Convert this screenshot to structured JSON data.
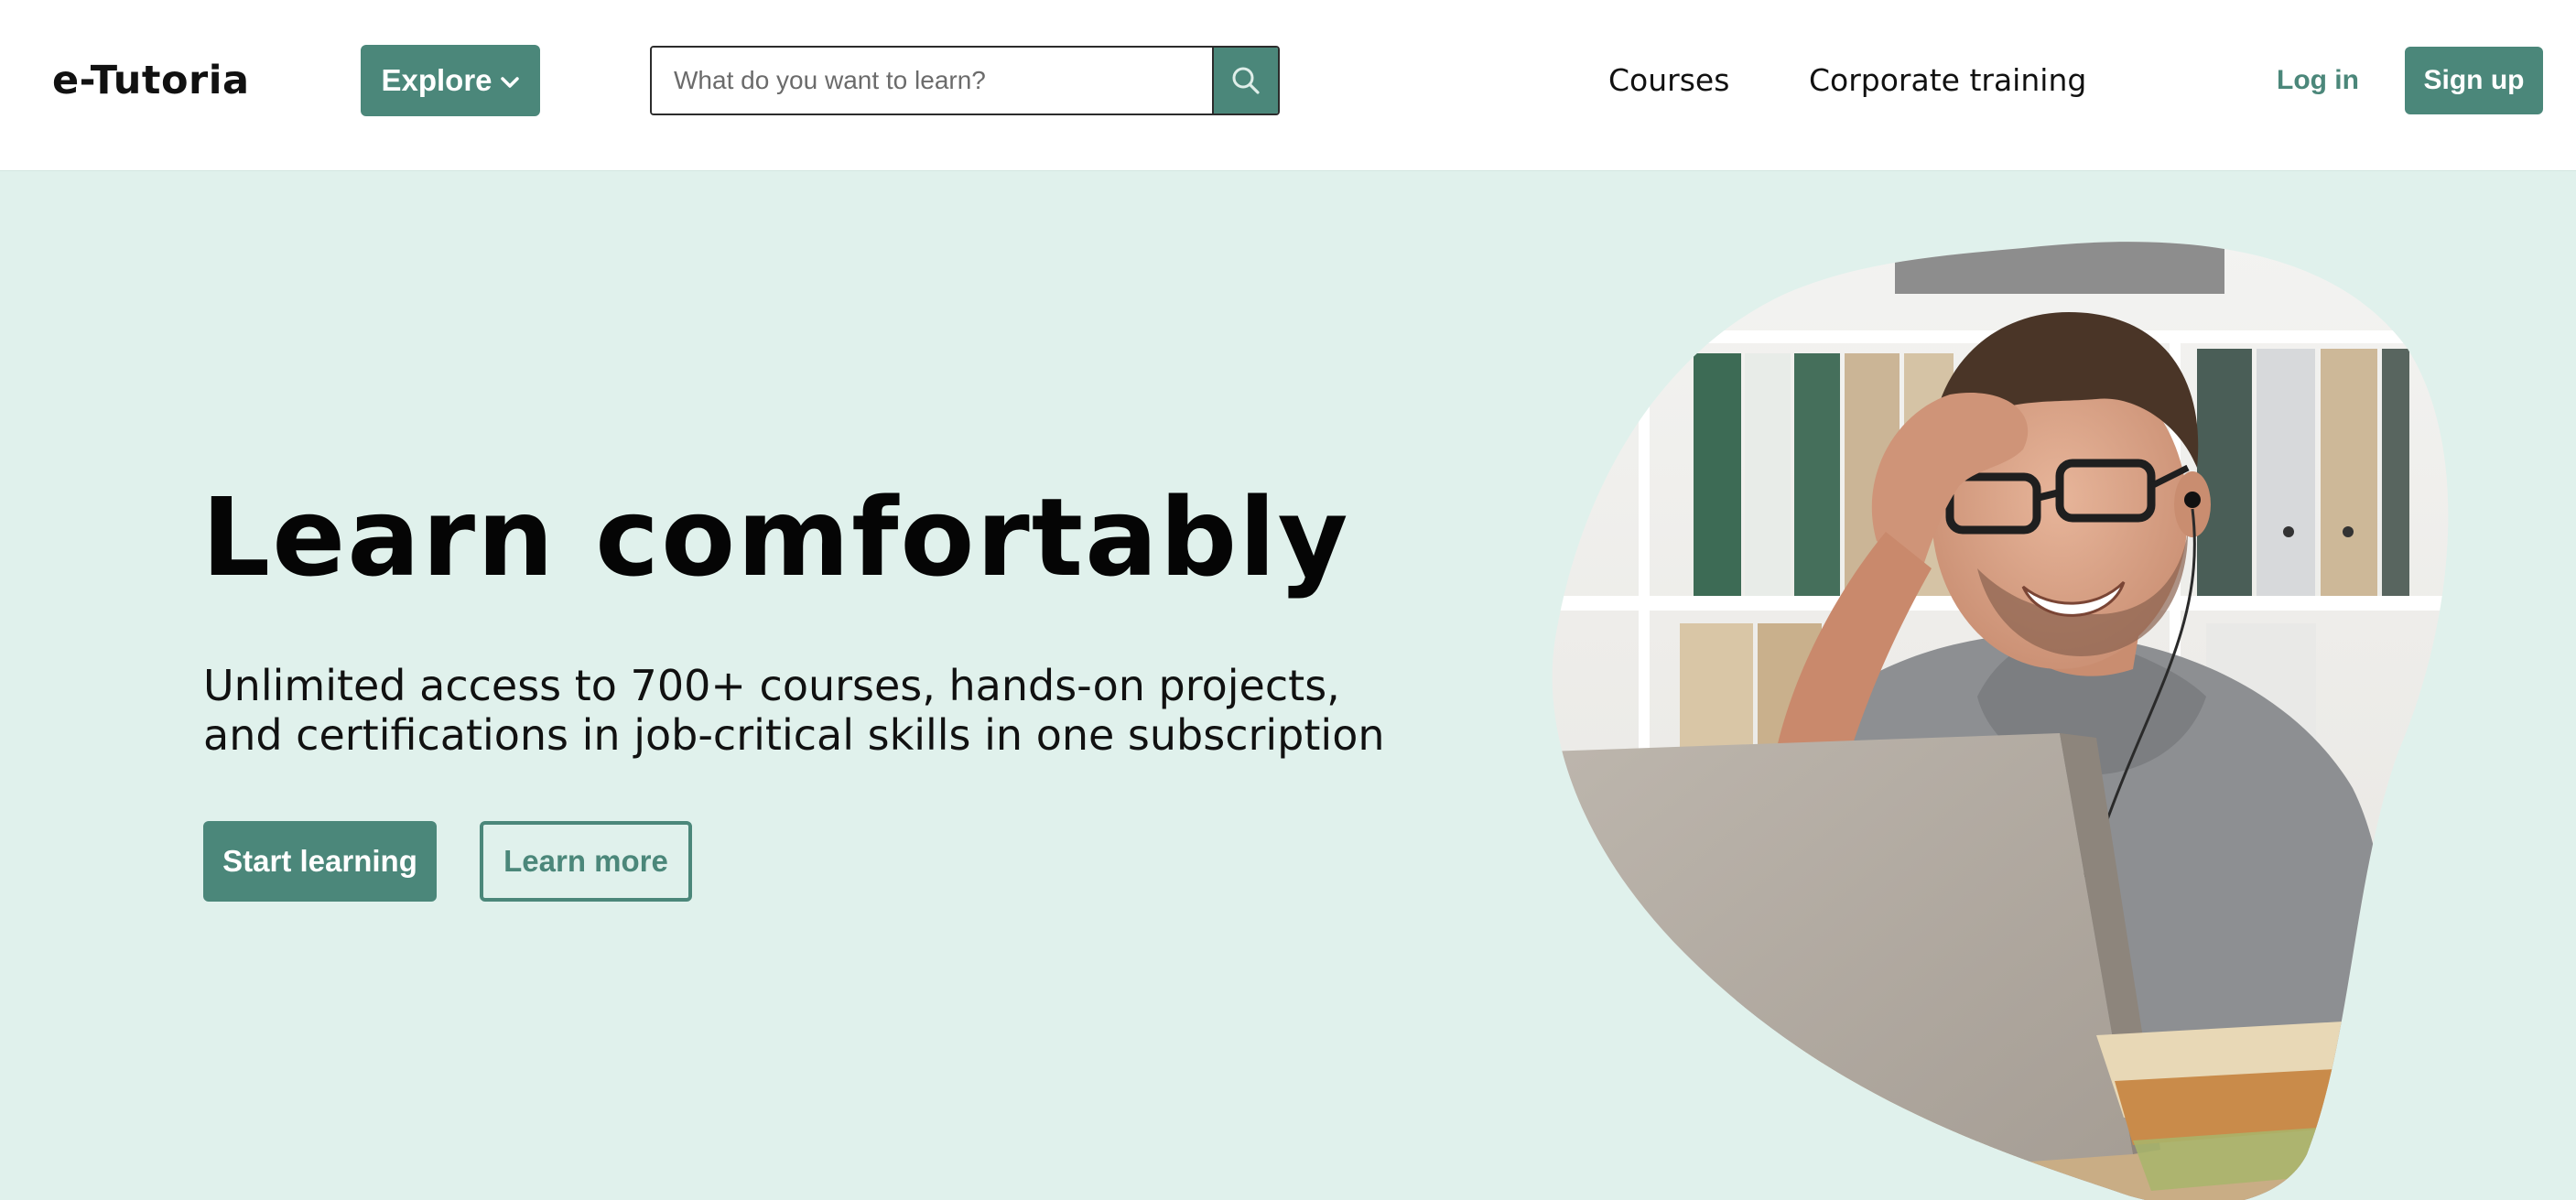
{
  "header": {
    "logo": "e-Tutoria",
    "explore_label": "Explore",
    "search": {
      "placeholder": "What do you want to learn?",
      "value": ""
    },
    "nav": [
      {
        "label": "Courses"
      },
      {
        "label": "Corporate training"
      }
    ],
    "login_label": "Log in",
    "signup_label": "Sign up"
  },
  "hero": {
    "title": "Learn comfortably",
    "subtitle": "Unlimited access to 700+ courses, hands-on projects, and certifications in job-critical skills in one subscription",
    "start_label": "Start learning",
    "learn_more_label": "Learn more",
    "image_description_icon": "person-studying-at-laptop-icon"
  },
  "colors": {
    "accent": "#4b877a",
    "hero_background": "#e0f1ec",
    "header_background": "#ffffff"
  }
}
